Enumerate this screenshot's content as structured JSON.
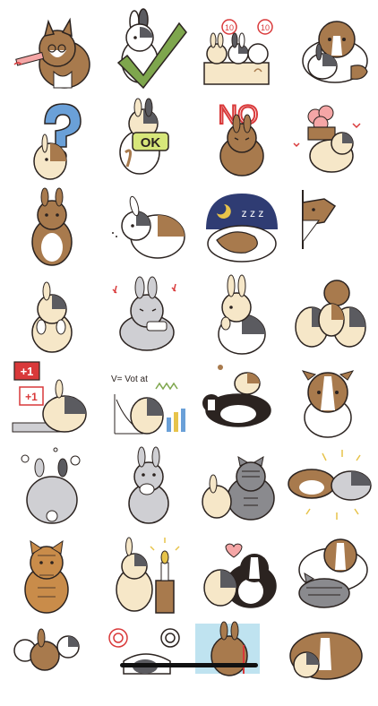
{
  "screen": {
    "title": "",
    "background": "#ffffff"
  },
  "palette": {
    "brown": "#a87a4d",
    "dark_brown": "#7a5636",
    "cream": "#f6e7c8",
    "white": "#ffffff",
    "gray": "#cfcfd3",
    "dark_gray": "#5b5b60",
    "pink": "#f5a6a6",
    "green": "#7ea64d",
    "blue": "#6aa0d8",
    "navy": "#2f3c73",
    "red": "#d9393a",
    "gold": "#e7c34a",
    "outline": "#2b2320"
  },
  "stickers": [
    {
      "id": "corgi-party-horn",
      "text": ""
    },
    {
      "id": "bunny-green-check",
      "text": ""
    },
    {
      "id": "bunnies-in-box-with-signs",
      "text": "10"
    },
    {
      "id": "collie-and-bunny",
      "text": ""
    },
    {
      "id": "bunny-question-mark",
      "text": ""
    },
    {
      "id": "bunny-ok-sign",
      "text": "OK"
    },
    {
      "id": "bunny-no",
      "text": "NO"
    },
    {
      "id": "bunny-flower-box",
      "text": ""
    },
    {
      "id": "bunny-standing",
      "text": ""
    },
    {
      "id": "bunny-sniffing",
      "text": ""
    },
    {
      "id": "corgi-sleeping-night",
      "text": "z z z"
    },
    {
      "id": "corgi-peeking-door",
      "text": ""
    },
    {
      "id": "bunny-paws-up",
      "text": ""
    },
    {
      "id": "gray-bunny-angry",
      "text": ""
    },
    {
      "id": "bunny-thinking",
      "text": ""
    },
    {
      "id": "bunny-pile",
      "text": ""
    },
    {
      "id": "bunny-plus-one",
      "text": "+1"
    },
    {
      "id": "bunny-math-board",
      "text": "V= Vot at"
    },
    {
      "id": "bordercollie-with-bunny",
      "text": ""
    },
    {
      "id": "collie-sitting",
      "text": ""
    },
    {
      "id": "gray-bunny-back-steam",
      "text": ""
    },
    {
      "id": "gray-bunny-covering-mouth",
      "text": ""
    },
    {
      "id": "bunny-and-tabby-cat",
      "text": ""
    },
    {
      "id": "corgi-and-gray-bunny-lying",
      "text": ""
    },
    {
      "id": "tabby-cat-sitting",
      "text": ""
    },
    {
      "id": "bunny-candle",
      "text": ""
    },
    {
      "id": "bordercollie-hug-heart",
      "text": ""
    },
    {
      "id": "collie-and-tabby-cat-lying",
      "text": ""
    },
    {
      "id": "bunnies-crowd",
      "text": ""
    },
    {
      "id": "cat-spiral-eyes",
      "text": ""
    },
    {
      "id": "bunny-in-water",
      "text": ""
    },
    {
      "id": "collie-and-bunny-cuddle",
      "text": ""
    }
  ]
}
